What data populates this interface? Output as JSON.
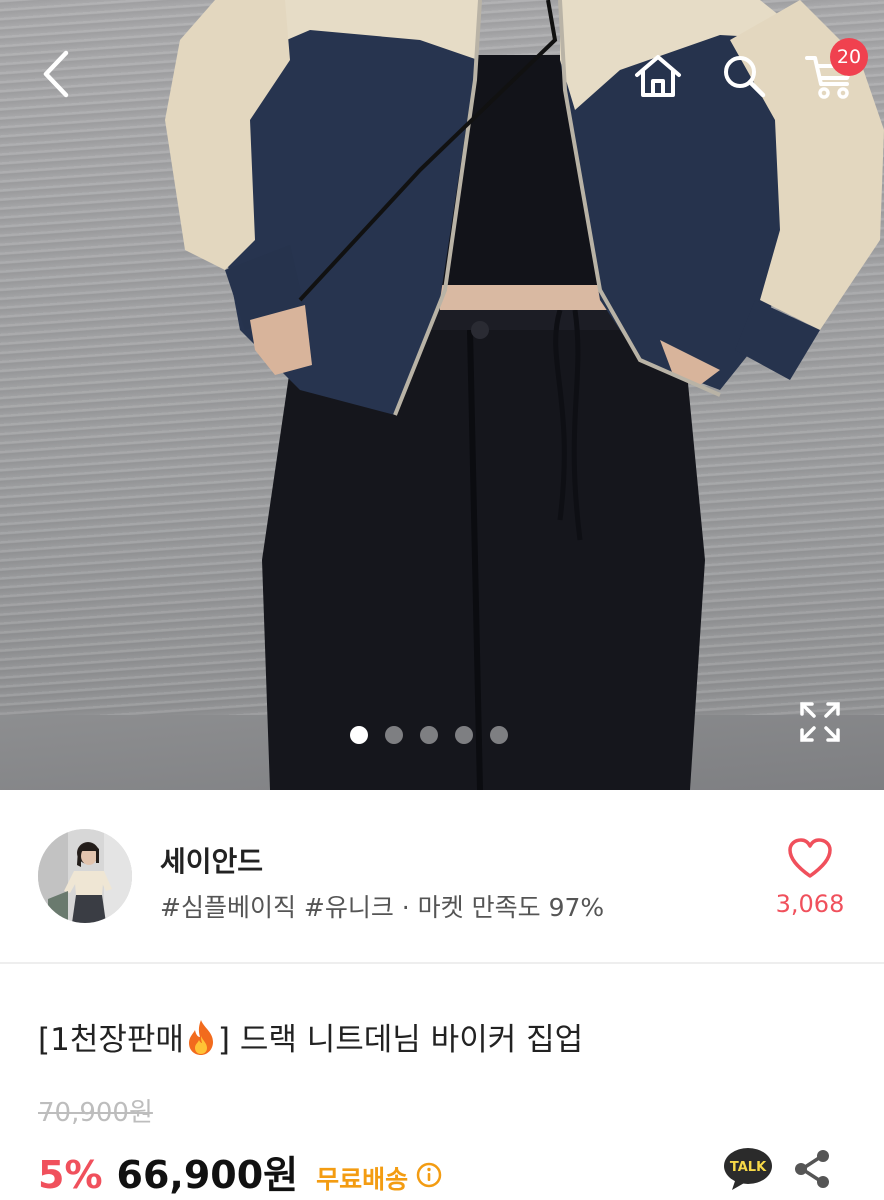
{
  "topbar": {
    "back_icon": "chevron-left-icon",
    "home_icon": "home-icon",
    "search_icon": "search-icon",
    "cart_icon": "cart-icon",
    "cart_count": "20"
  },
  "gallery": {
    "dot_count": 5,
    "active_index": 0,
    "expand_icon": "expand-icon"
  },
  "shop": {
    "name": "세이안드",
    "tags": "#심플베이직 #유니크 · 마켓 만족도 97%",
    "like_count": "3,068"
  },
  "product": {
    "title_prefix": "[1천장판매",
    "title_suffix": "] 드랙 니트데님 바이커 집업",
    "original_price": "70,900원",
    "discount": "5%",
    "price": "66,900원",
    "shipping": "무료배송"
  },
  "actions": {
    "talk_label": "TALK",
    "share_icon": "share-icon"
  },
  "colors": {
    "accent": "#f0505c",
    "badge": "#f0414f",
    "shipping": "#f39c12",
    "talk": "#2b2b2b"
  }
}
